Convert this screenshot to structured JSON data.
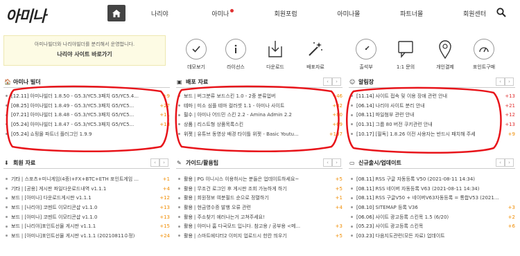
{
  "header": {
    "logo": "아미나",
    "nav": [
      {
        "label": "나리야"
      },
      {
        "label": "아미나",
        "dot": true
      },
      {
        "label": "회원포럼"
      },
      {
        "label": "아미나몰"
      },
      {
        "label": "파트너몰"
      },
      {
        "label": "회원센터"
      }
    ]
  },
  "promo": {
    "text": "아미나빌더와 나리야빌더를 분리해서 운영합니다.",
    "link": "나리야 사이트 바로가기"
  },
  "quick_left": [
    {
      "label": "데모보기",
      "icon": "check-circle-icon"
    },
    {
      "label": "라이선스",
      "icon": "info-circle-icon"
    },
    {
      "label": "다운로드",
      "icon": "download-icon"
    },
    {
      "label": "배포자료",
      "icon": "magic-wand-icon"
    }
  ],
  "quick_right": [
    {
      "label": "출석부",
      "icon": "stopwatch-icon"
    },
    {
      "label": "1:1 문의",
      "icon": "chat-icon"
    },
    {
      "label": "개인결제",
      "icon": "map-marker-icon"
    },
    {
      "label": "포인트구매",
      "icon": "gauge-icon"
    }
  ],
  "panels": [
    {
      "title": "아미나 빌더",
      "icon": "home-icon",
      "rows": [
        {
          "cat": "[12.11]",
          "text": "아미나빌더 1.8.50 - G5.3/YC5.3패치 G5/YC5.4...",
          "count": "+9"
        },
        {
          "cat": "[08.25]",
          "text": "아미나빌더 1.8.49 - G5.3/YC5.3패치 G5/YC5...",
          "count": "+27"
        },
        {
          "cat": "[07.21]",
          "text": "아미나빌더 1.8.48 - G5.3/YC5.3패치 G5/YC5...",
          "count": "+11"
        },
        {
          "cat": "[05.24]",
          "text": "아미나빌더 1.8.47 - G5.3/YC5.3패치 G5/YC5...",
          "count": "+18"
        },
        {
          "cat": "[05.24]",
          "text": "쇼핑몰 파트너 플러그인 1.9.9",
          "count": ""
        }
      ]
    },
    {
      "title": "배포 자료",
      "icon": "box-icon",
      "rows": [
        {
          "cat": "보드",
          "text": "| 버그분류 보드스킨 1.0 - 2중 분류업버",
          "count": "+46"
        },
        {
          "cat": "테마",
          "text": "| 미소 심플 테마 컬러셋 1.1 - 아미나 사이트",
          "count": "+32"
        },
        {
          "cat": "필수",
          "text": "| 아미나 어드민 스킨 2.2 - Amina Admin 2.2",
          "count": "+80"
        },
        {
          "cat": "상품",
          "text": "| 리스트형 상품목록스킨",
          "count": "+69"
        },
        {
          "cat": "위젯",
          "text": "| 유튜브 동영상 배경 타이틀 위젯 - Basic Youtu...",
          "count": "+137"
        }
      ]
    },
    {
      "title": "알림장",
      "icon": "smile-icon",
      "rows": [
        {
          "cat": "[11.14]",
          "text": "사이트 접속 및 이용 장애 관련 안내",
          "count": "+13"
        },
        {
          "cat": "[06.14]",
          "text": "나리야 사이트 분리 안내",
          "count": "+21"
        },
        {
          "cat": "[08.11]",
          "text": "파일첨부 관련 안내",
          "count": "+12"
        },
        {
          "cat": "[01.31]",
          "text": "그룹 80 버전 쿠키관련 안내",
          "count": "+13"
        },
        {
          "cat": "[10.17]",
          "text": "[필독] 1.8.26 이전 사용자는 반드시 패치해 주세",
          "count": "+9"
        }
      ]
    },
    {
      "title": "회원 자료",
      "icon": "download-icon",
      "rows": [
        {
          "cat": "기타",
          "text": "| 스포츠+미니게임(4종)+FX+BTC+ETH 포인트게임 ...",
          "count": "+1"
        },
        {
          "cat": "기타",
          "text": "| [공용] 게시판 파일다운로드내역 v1.1.1",
          "count": "+4"
        },
        {
          "cat": "보드",
          "text": "| [아미나] 다운로드게시판 v1.1.1",
          "count": "+12"
        },
        {
          "cat": "보드",
          "text": "| [나리야] 코멘트 이모티콘샵 v1.1.0",
          "count": "+13"
        },
        {
          "cat": "보드",
          "text": "| [아미나] 코멘트 이모티콘샵 v1.1.0",
          "count": "+13"
        },
        {
          "cat": "보드",
          "text": "| [나리야]포인트선물 게시판 v1.1.1",
          "count": "+15"
        },
        {
          "cat": "보드",
          "text": "| [아미나]포인트선물 게시판 v1.1.1 (20210811수정)",
          "count": "+24"
        }
      ]
    },
    {
      "title": "가이드/활용팁",
      "icon": "pencil-icon",
      "rows": [
        {
          "cat": "활용",
          "text": "| PG 이니시스 이용하시는 분들은 업데이트하세요~",
          "count": "+5"
        },
        {
          "cat": "활용",
          "text": "| 무조건 로그인 후 게시판 조회 가능하게 하기",
          "count": "+5"
        },
        {
          "cat": "활용",
          "text": "| 회원정보 여분필드 순으로 정렬하기",
          "count": "+1"
        },
        {
          "cat": "활용",
          "text": "| 현금영수증 발행 오류 관련",
          "count": "+4"
        },
        {
          "cat": "활용",
          "text": "| 주소찾기 에러나는거 고쳐주세요!",
          "count": ""
        },
        {
          "cat": "활용",
          "text": "| 아미나 홈 다국모드 입니다. 참고용 / 공부용 <메...",
          "count": "+3"
        },
        {
          "cat": "활용",
          "text": "| 스마트에디터2 이미지 업로드시 한칸 띄우기",
          "count": "+5"
        }
      ]
    },
    {
      "title": "신규출시/업데이트",
      "icon": "desktop-icon",
      "rows": [
        {
          "cat": "[08.11]",
          "text": "RSS 구글 자동등록 V50 (2021-08-11 14:34)",
          "count": ""
        },
        {
          "cat": "[08.11]",
          "text": "RSS 네이버 자동등록 V63 (2021-08-11 14:34)",
          "count": ""
        },
        {
          "cat": "[08.11]",
          "text": "RSS 구글V50 + 네이버V63자동등록 = 통합V53 (2021-...",
          "count": ""
        },
        {
          "cat": "[08.10]",
          "text": "SITEMAP 등록 V36",
          "count": "+3"
        },
        {
          "cat": "[06.06]",
          "text": "사이트 광고등록 스킨목 1.5 (6/20)",
          "count": "+2"
        },
        {
          "cat": "[05.23]",
          "text": "사이트 광고등록 스킨목",
          "count": "+6"
        },
        {
          "cat": "[03.23]",
          "text": "다음지도관련(모든 자료) 업데이트",
          "count": ""
        }
      ]
    }
  ]
}
